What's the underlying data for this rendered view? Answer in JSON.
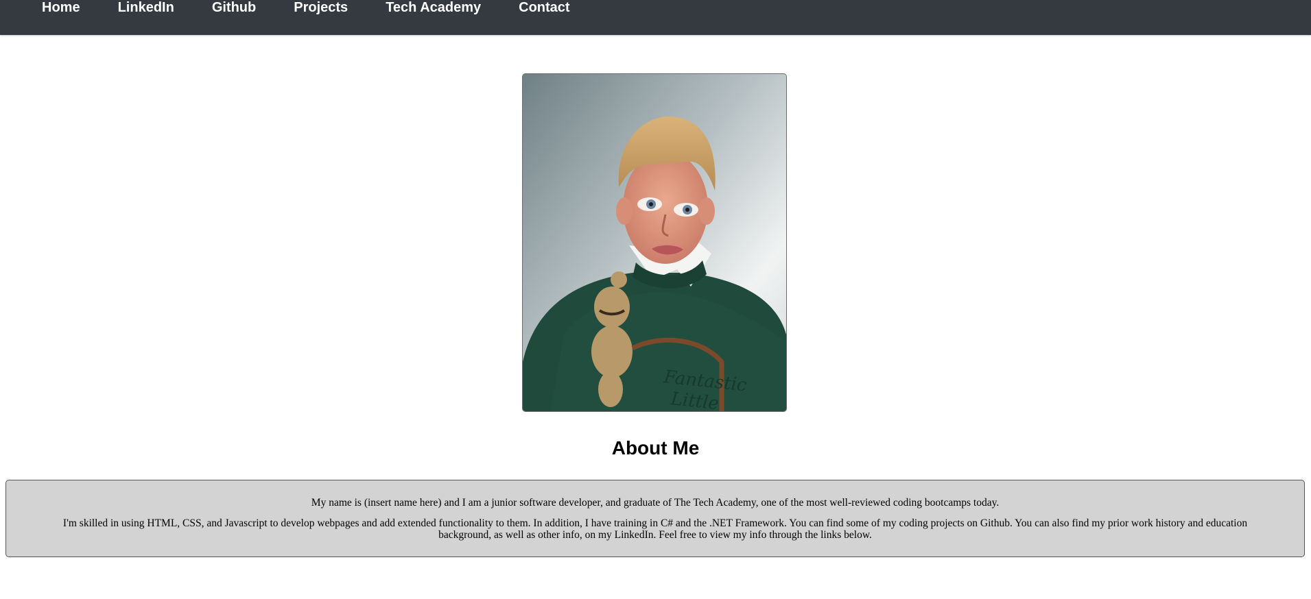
{
  "nav": {
    "items": [
      {
        "label": "Home"
      },
      {
        "label": "LinkedIn"
      },
      {
        "label": "Github"
      },
      {
        "label": "Projects"
      },
      {
        "label": "Tech Academy"
      },
      {
        "label": "Contact"
      }
    ]
  },
  "profile": {
    "photo_icon": "portrait-photo",
    "sweater_text": "Fantastic Little"
  },
  "about": {
    "heading": "About Me",
    "paragraph1": "My name is (insert name here) and I am a junior software developer, and graduate of The Tech Academy, one of the most well-reviewed coding bootcamps today.",
    "paragraph2": "I'm skilled in using HTML, CSS, and Javascript to develop webpages and add extended functionality to them. In addition, I have training in C# and the .NET Framework. You can find some of my coding projects on Github. You can also find my prior work history and education background, as well as other info, on my LinkedIn. Feel free to view my info through the links below."
  },
  "colors": {
    "navbar": "#343a40",
    "nav_text": "#ffffff",
    "about_box": "#d3d3d3"
  }
}
